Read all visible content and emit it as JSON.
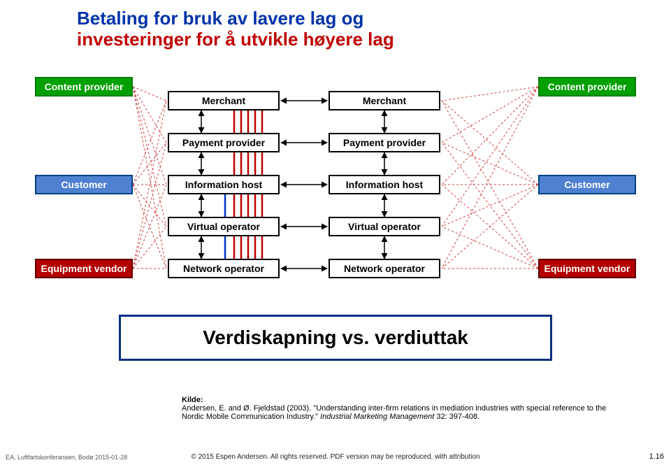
{
  "title": {
    "line1": "Betaling for bruk av lavere lag og",
    "line2": "investeringer for å utvikle høyere lag"
  },
  "boxes": {
    "content_provider_left": {
      "label": "Content provider"
    },
    "content_provider_right": {
      "label": "Content provider"
    },
    "customer_left": {
      "label": "Customer"
    },
    "customer_right": {
      "label": "Customer"
    },
    "equipment_vendor_left": {
      "label": "Equipment vendor"
    },
    "equipment_vendor_right": {
      "label": "Equipment vendor"
    },
    "merchant_left": {
      "label": "Merchant"
    },
    "merchant_right": {
      "label": "Merchant"
    },
    "payment_left": {
      "label": "Payment provider"
    },
    "payment_right": {
      "label": "Payment provider"
    },
    "info_left": {
      "label": "Information host"
    },
    "info_right": {
      "label": "Information host"
    },
    "virtual_left": {
      "label": "Virtual operator"
    },
    "virtual_right": {
      "label": "Virtual operator"
    },
    "network_left": {
      "label": "Network operator"
    },
    "network_right": {
      "label": "Network operator"
    }
  },
  "banner": {
    "text": "Verdiskapning vs. verdiuttak"
  },
  "source": {
    "kilde": "Kilde:",
    "citation_plain": "Andersen, E. and Ø. Fjeldstad (2003). \"Understanding inter-firm relations in mediation industries with special reference to the Nordic Mobile Communication Industry.\" ",
    "citation_italic": "Industrial Marketing Management",
    "citation_tail": " 32: 397-408."
  },
  "footer": {
    "left": "EA, Luftfartskonferansen, Bodø 2015-01-28",
    "center": "© 2015 Espen Andersen. All rights reserved. PDF version may be reproduced, with attribution",
    "right": "1.16"
  },
  "chart_data": {
    "type": "diagram",
    "title": "Betaling for bruk av lavere lag og investeringer for å utvikle høyere lag",
    "layers_center_left_to_right_stack": [
      "Merchant",
      "Payment provider",
      "Information host",
      "Virtual operator",
      "Network operator"
    ],
    "outer_roles_left": [
      "Content provider",
      "Customer",
      "Equipment vendor"
    ],
    "outer_roles_right": [
      "Content provider",
      "Customer",
      "Equipment vendor"
    ],
    "connections": {
      "horizontal_bidirectional_between_columns": [
        [
          "Merchant",
          "Merchant"
        ],
        [
          "Payment provider",
          "Payment provider"
        ],
        [
          "Information host",
          "Information host"
        ],
        [
          "Virtual operator",
          "Virtual operator"
        ],
        [
          "Network operator",
          "Network operator"
        ]
      ],
      "vertical_bidirectional_left_column": [
        [
          "Merchant",
          "Payment provider"
        ],
        [
          "Payment provider",
          "Information host"
        ],
        [
          "Information host",
          "Virtual operator"
        ],
        [
          "Virtual operator",
          "Network operator"
        ]
      ],
      "vertical_bidirectional_right_column": [
        [
          "Merchant",
          "Payment provider"
        ],
        [
          "Payment provider",
          "Information host"
        ],
        [
          "Information host",
          "Virtual operator"
        ],
        [
          "Virtual operator",
          "Network operator"
        ]
      ],
      "red_dashed_fan_from_outer_to_all_layers": [
        {
          "from": "Content provider (left)",
          "to_all_left_layers": true
        },
        {
          "from": "Customer (left)",
          "to_all_left_layers": true
        },
        {
          "from": "Equipment vendor (left)",
          "to_all_left_layers": true
        },
        {
          "from": "Content provider (right)",
          "to_all_right_layers": true
        },
        {
          "from": "Customer (right)",
          "to_all_right_layers": true
        },
        {
          "from": "Equipment vendor (right)",
          "to_all_right_layers": true
        }
      ],
      "colored_vertical_flows_inside_left_column": {
        "red_up_arrows_count": 5,
        "blue_up_arrow_count": 1,
        "description": "Red arrows rise from Network operator up through each layer to Merchant; blue arrow rises up to Information host"
      }
    },
    "banner": "Verdiskapning vs. verdiuttak"
  }
}
